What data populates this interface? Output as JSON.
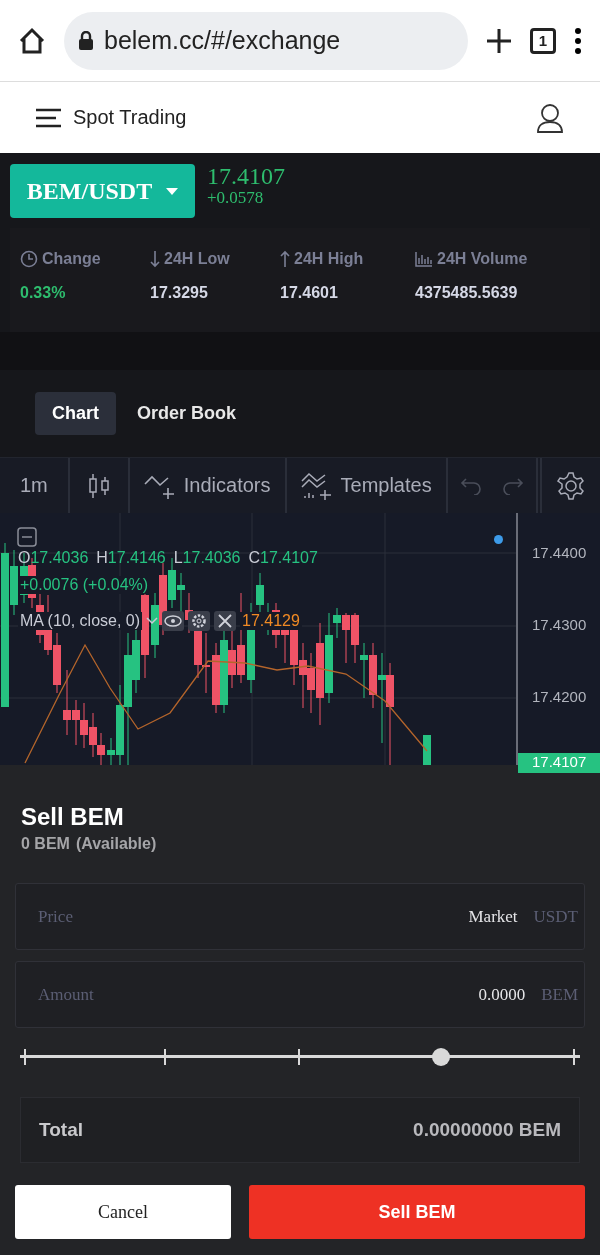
{
  "browser": {
    "url": "belem.cc/#/exchange",
    "tab_count": "1"
  },
  "header": {
    "title": "Spot Trading"
  },
  "market": {
    "pair": "BEM/USDT",
    "price": "17.4107",
    "change": "+0.0578",
    "stats": [
      {
        "kind": "clock",
        "label": "Change",
        "value": "0.33%",
        "positive": true
      },
      {
        "kind": "down",
        "label": "24H Low",
        "value": "17.3295",
        "positive": false
      },
      {
        "kind": "up",
        "label": "24H High",
        "value": "17.4601",
        "positive": false
      },
      {
        "kind": "volume",
        "label": "24H Volume",
        "value": "4375485.5639",
        "positive": false
      }
    ]
  },
  "view_tabs": [
    {
      "label": "Chart",
      "selected": true
    },
    {
      "label": "Order Book",
      "selected": false
    }
  ],
  "chart_toolbar": {
    "interval": "1m",
    "indicators": "Indicators",
    "templates": "Templates"
  },
  "chart": {
    "ohlc": [
      {
        "label": "O",
        "value": "17.4036"
      },
      {
        "label": "H",
        "value": "17.4146"
      },
      {
        "label": "L",
        "value": "17.4036"
      },
      {
        "label": "C",
        "value": "17.4107"
      }
    ],
    "change": "+0.0076 (+0.04%)",
    "ma_label": "MA (10, close, 0)",
    "ma_value": "17.4129",
    "axis_labels": [
      "17.4400",
      "17.4300",
      "17.4200"
    ],
    "last_price": "17.4107"
  },
  "order": {
    "title": "Sell BEM",
    "available": "0 BEM",
    "available_note": "(Available)",
    "fields": [
      {
        "label": "Price",
        "value": "Market",
        "unit": "USDT"
      },
      {
        "label": "Amount",
        "value": "0.0000",
        "unit": "BEM"
      }
    ],
    "slider": {
      "level": 0.75
    },
    "total_label": "Total",
    "total_value": "0.00000000 BEM",
    "buttons": [
      {
        "kind": "cancel",
        "label": "Cancel"
      },
      {
        "kind": "submit",
        "label": "Sell BEM"
      }
    ]
  }
}
